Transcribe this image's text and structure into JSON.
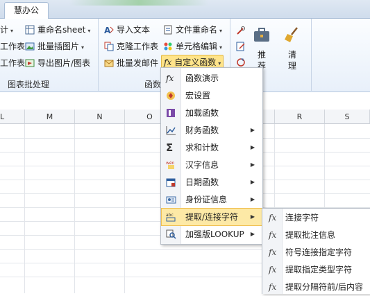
{
  "tab": {
    "label": "慧办公"
  },
  "ribbon": {
    "left_items": [
      "计",
      "工作表",
      "工作表"
    ],
    "col2": [
      {
        "label": "重命名sheet",
        "icon": "rename-sheet-icon",
        "caret": true
      },
      {
        "label": "批量插图片",
        "icon": "insert-images-icon",
        "caret": true
      },
      {
        "label": "导出图片/图表",
        "icon": "export-image-icon",
        "caret": false
      }
    ],
    "col3": [
      {
        "label": "导入文本",
        "icon": "import-text-icon"
      },
      {
        "label": "克隆工作表",
        "icon": "clone-sheet-icon"
      },
      {
        "label": "批量发邮件",
        "icon": "batch-mail-icon"
      }
    ],
    "col4": [
      {
        "label": "文件重命名",
        "icon": "file-rename-icon",
        "caret": true
      },
      {
        "label": "单元格编辑",
        "icon": "cell-edit-icon",
        "caret": true
      },
      {
        "label": "自定义函数",
        "icon": "fx-icon",
        "caret": true
      }
    ],
    "big_buttons": [
      {
        "label_1": "推",
        "label_2": "荐",
        "icon": "recommend-icon"
      },
      {
        "label_1": "清",
        "label_2": "理",
        "icon": "broom-icon"
      }
    ],
    "groups": [
      "图表批处理",
      "函数"
    ]
  },
  "columns": [
    "L",
    "M",
    "N",
    "O",
    "R",
    "S"
  ],
  "menu": {
    "items": [
      {
        "label": "函数演示",
        "icon": "fx-icon",
        "submenu": false
      },
      {
        "label": "宏设置",
        "icon": "macro-icon",
        "submenu": false
      },
      {
        "label": "加载函数",
        "icon": "load-function-icon",
        "submenu": false
      },
      {
        "label": "财务函数",
        "icon": "finance-icon",
        "submenu": true
      },
      {
        "label": "求和计数",
        "icon": "sigma-icon",
        "submenu": true
      },
      {
        "label": "汉字信息",
        "icon": "chinese-char-icon",
        "submenu": true
      },
      {
        "label": "日期函数",
        "icon": "calendar-icon",
        "submenu": true
      },
      {
        "label": "身份证信息",
        "icon": "id-card-icon",
        "submenu": true
      },
      {
        "label": "提取/连接字符",
        "icon": "text-extract-icon",
        "submenu": true,
        "active": true
      },
      {
        "label": "加强版LOOKUP",
        "icon": "lookup-icon",
        "submenu": true
      }
    ]
  },
  "submenu": {
    "items": [
      {
        "label": "连接字符"
      },
      {
        "label": "提取批注信息"
      },
      {
        "label": "符号连接指定字符"
      },
      {
        "label": "提取指定类型字符"
      },
      {
        "label": "提取分隔符前/后内容"
      }
    ],
    "icon_glyph": "fx"
  },
  "colors": {
    "accent": "#ffe48a",
    "menu_highlight": "#fde9a6"
  }
}
